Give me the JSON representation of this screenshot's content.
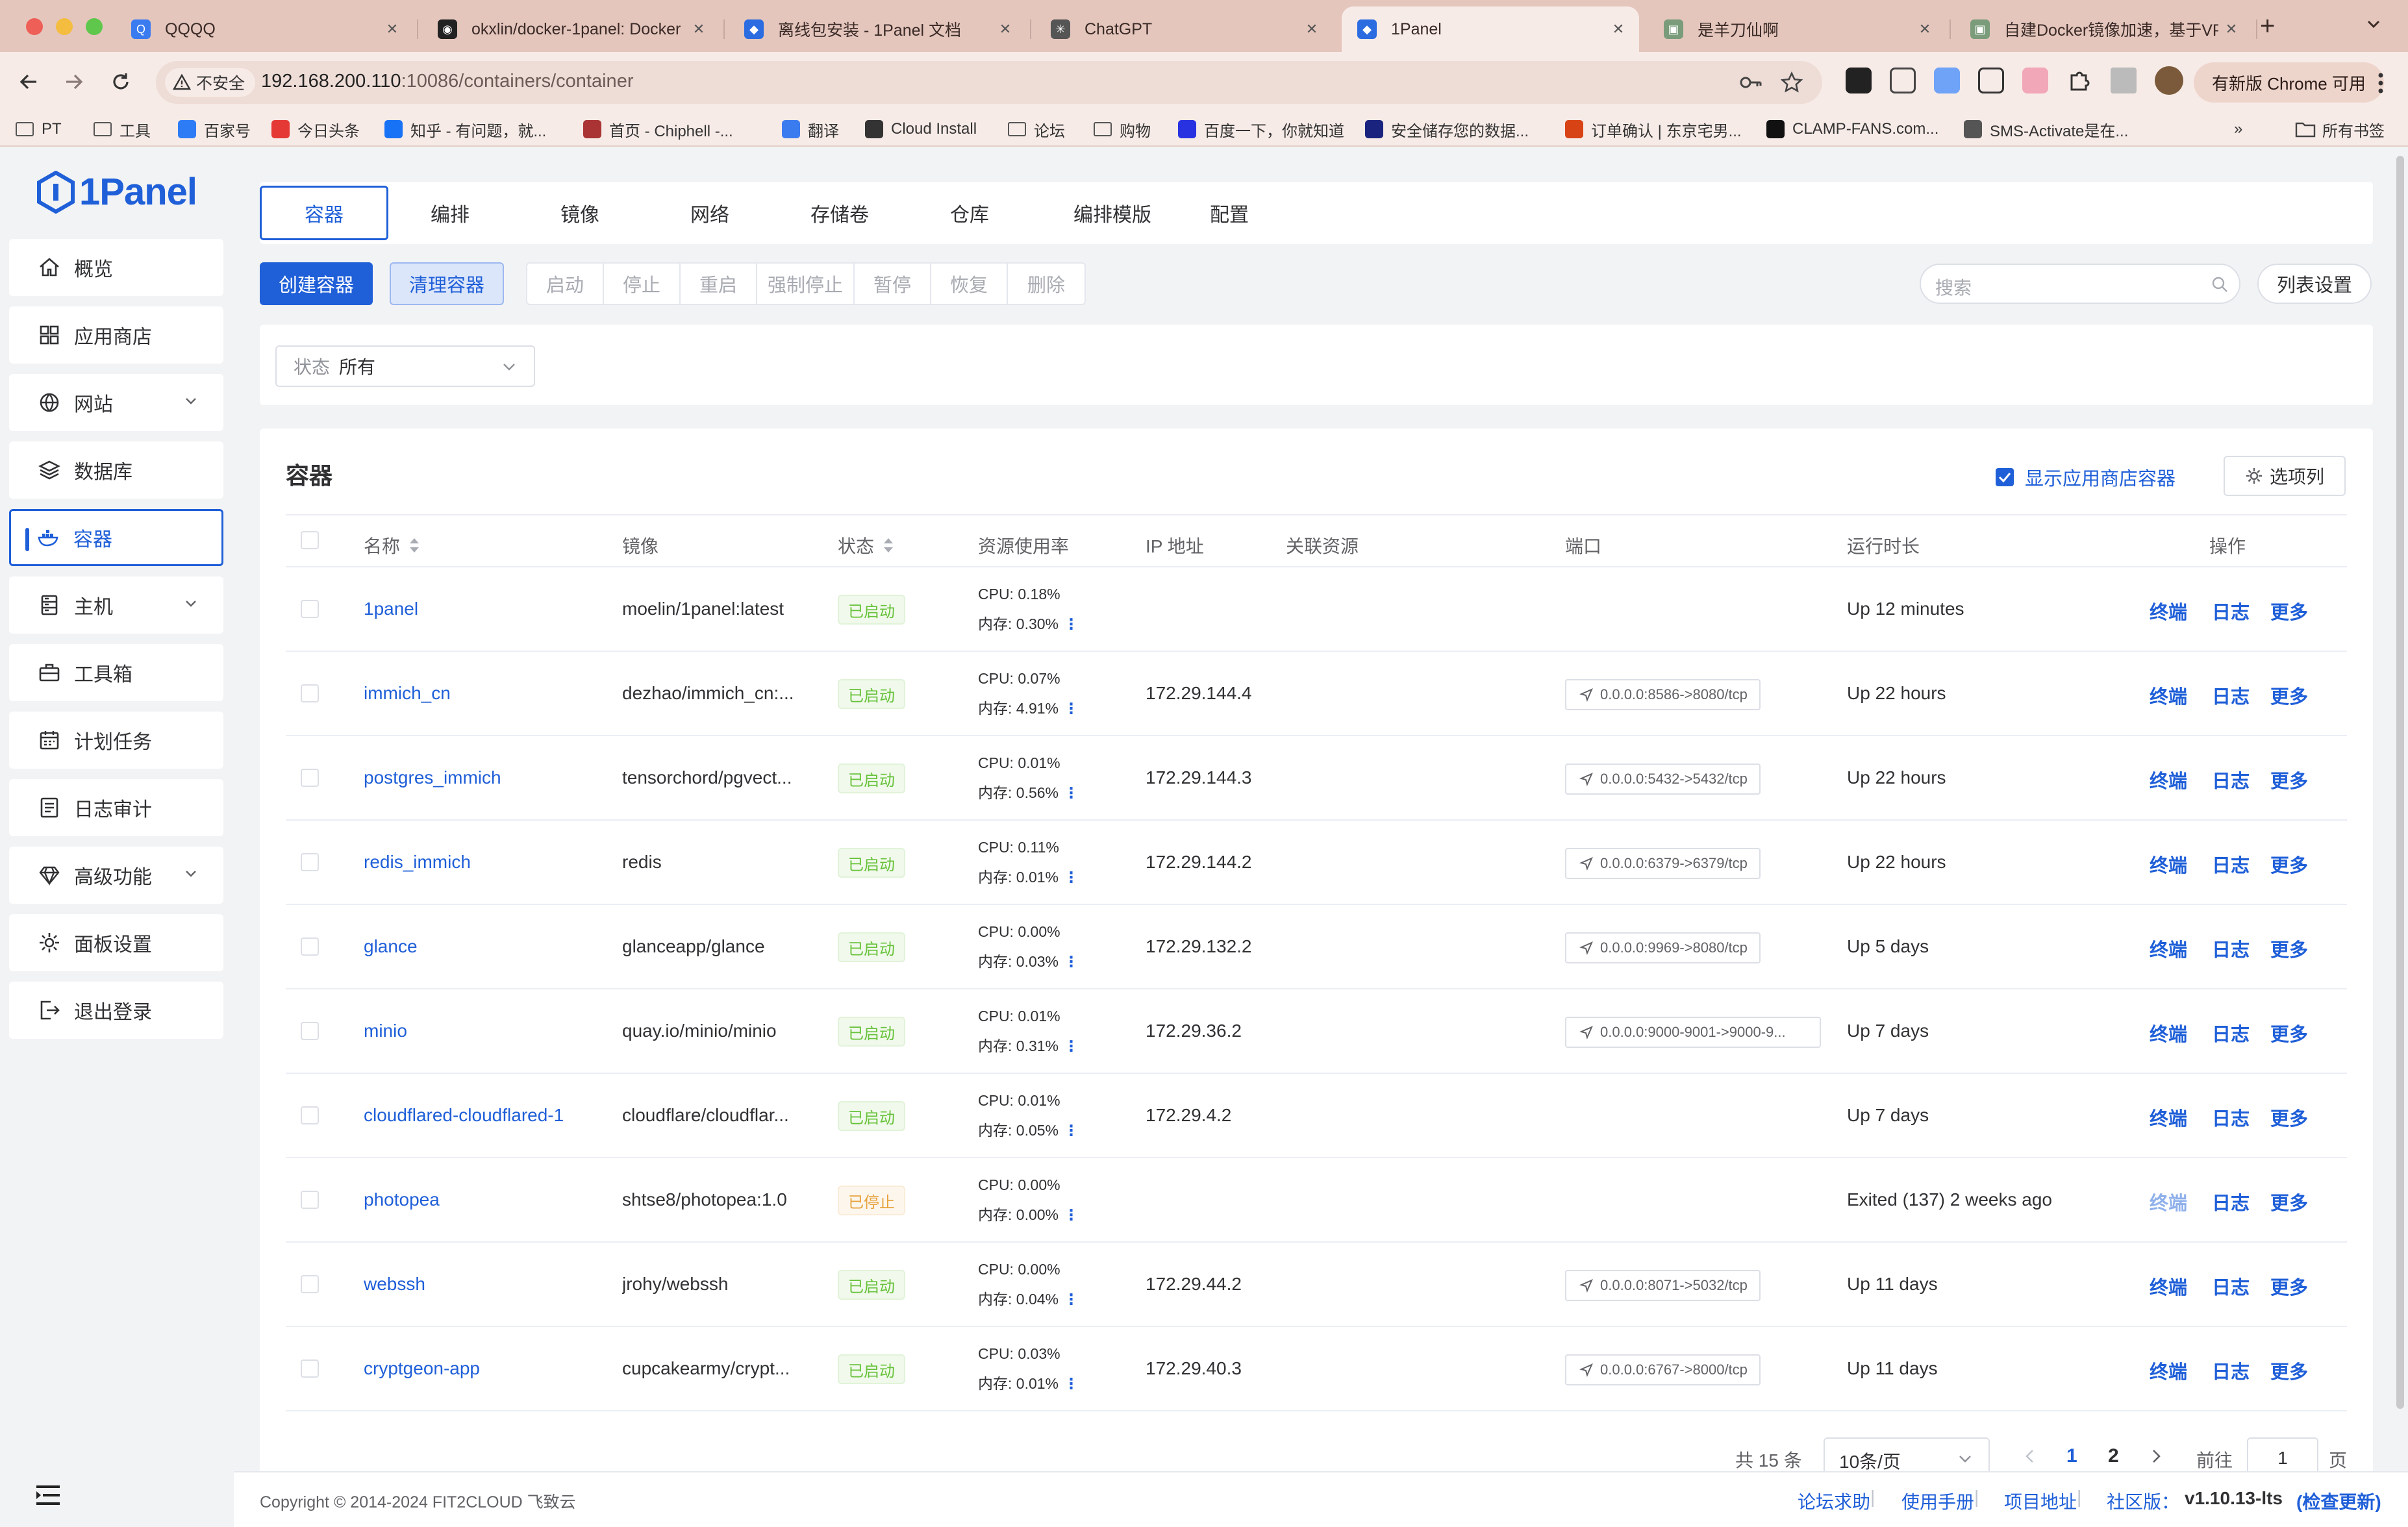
{
  "browser": {
    "tabs": [
      {
        "title": "QQQQ",
        "color": "#3b7bf0",
        "glyph": "Q"
      },
      {
        "title": "okxlin/docker-1panel: Docker",
        "color": "#222",
        "glyph": "◉"
      },
      {
        "title": "离线包安装 - 1Panel 文档",
        "color": "#2b6ce0",
        "glyph": "◆"
      },
      {
        "title": "ChatGPT",
        "color": "#555",
        "glyph": "✳"
      },
      {
        "title": "1Panel",
        "color": "#2b6ce0",
        "glyph": "◆"
      },
      {
        "title": "是羊刀仙啊",
        "color": "#7a9c7a",
        "glyph": "▣"
      },
      {
        "title": "自建Docker镜像加速，基于VP",
        "color": "#7a9c7a",
        "glyph": "▣"
      }
    ],
    "insecure_label": "不安全",
    "url_host": "192.168.200.110",
    "url_rest": ":10086/containers/container",
    "update_label": "有新版 Chrome 可用",
    "bookmarks": [
      {
        "label": "PT",
        "color": "#555"
      },
      {
        "label": "工具",
        "color": "#555"
      },
      {
        "label": "百家号",
        "color": "#2d7cf6"
      },
      {
        "label": "今日头条",
        "color": "#e53935"
      },
      {
        "label": "知乎 - 有问题，就...",
        "color": "#1772f6"
      },
      {
        "label": "首页 - Chiphell -...",
        "color": "#a33"
      },
      {
        "label": "翻译",
        "color": "#3b7bf0"
      },
      {
        "label": "Cloud Install",
        "color": "#333"
      },
      {
        "label": "论坛",
        "color": "#555"
      },
      {
        "label": "购物",
        "color": "#555"
      },
      {
        "label": "百度一下，你就知道",
        "color": "#2932e1"
      },
      {
        "label": "安全储存您的数据...",
        "color": "#1a237e"
      },
      {
        "label": "订单确认 | 东京宅男...",
        "color": "#d84315"
      },
      {
        "label": "CLAMP-FANS.com...",
        "color": "#111"
      },
      {
        "label": "SMS-Activate是在...",
        "color": "#555"
      }
    ],
    "all_bookmarks": "所有书签",
    "more_bookmarks": "»"
  },
  "brand": {
    "logo": "1Panel",
    "color": "#1f5fd8"
  },
  "sidebar": {
    "items": [
      {
        "label": "概览",
        "icon": "home-icon",
        "has_arrow": false
      },
      {
        "label": "应用商店",
        "icon": "grid-icon",
        "has_arrow": false
      },
      {
        "label": "网站",
        "icon": "globe-icon",
        "has_arrow": true
      },
      {
        "label": "数据库",
        "icon": "layers-icon",
        "has_arrow": false
      },
      {
        "label": "容器",
        "icon": "docker-icon",
        "has_arrow": false,
        "active": true
      },
      {
        "label": "主机",
        "icon": "server-icon",
        "has_arrow": true
      },
      {
        "label": "工具箱",
        "icon": "toolbox-icon",
        "has_arrow": false
      },
      {
        "label": "计划任务",
        "icon": "calendar-icon",
        "has_arrow": false
      },
      {
        "label": "日志审计",
        "icon": "log-icon",
        "has_arrow": false
      },
      {
        "label": "高级功能",
        "icon": "diamond-icon",
        "has_arrow": true
      },
      {
        "label": "面板设置",
        "icon": "gear-icon",
        "has_arrow": false
      },
      {
        "label": "退出登录",
        "icon": "logout-icon",
        "has_arrow": false
      }
    ]
  },
  "subtabs": [
    "容器",
    "编排",
    "镜像",
    "网络",
    "存储卷",
    "仓库",
    "编排模版",
    "配置"
  ],
  "toolbar": {
    "create": "创建容器",
    "prune": "清理容器",
    "actions": [
      "启动",
      "停止",
      "重启",
      "强制停止",
      "暂停",
      "恢复",
      "删除"
    ],
    "search_placeholder": "搜索",
    "columns": "列表设置"
  },
  "filter": {
    "label": "状态",
    "value": "所有"
  },
  "table": {
    "title": "容器",
    "show_app_label": "显示应用商店容器",
    "option_columns": "选项列",
    "headers": {
      "name": "名称",
      "image": "镜像",
      "state": "状态",
      "resource": "资源使用率",
      "ip": "IP 地址",
      "related": "关联资源",
      "ports": "端口",
      "uptime": "运行时长",
      "ops": "操作"
    },
    "rows": [
      {
        "name": "1panel",
        "image": "moelin/1panel:latest",
        "state": "已启动",
        "cpu": "CPU: 0.18%",
        "mem": "内存: 0.30%",
        "ip": "",
        "port": "",
        "uptime": "Up 12 minutes",
        "running": true
      },
      {
        "name": "immich_cn",
        "image": "dezhao/immich_cn:...",
        "state": "已启动",
        "cpu": "CPU: 0.07%",
        "mem": "内存: 4.91%",
        "ip": "172.29.144.4",
        "port": "0.0.0.0:8586->8080/tcp",
        "uptime": "Up 22 hours",
        "running": true
      },
      {
        "name": "postgres_immich",
        "image": "tensorchord/pgvect...",
        "state": "已启动",
        "cpu": "CPU: 0.01%",
        "mem": "内存: 0.56%",
        "ip": "172.29.144.3",
        "port": "0.0.0.0:5432->5432/tcp",
        "uptime": "Up 22 hours",
        "running": true
      },
      {
        "name": "redis_immich",
        "image": "redis",
        "state": "已启动",
        "cpu": "CPU: 0.11%",
        "mem": "内存: 0.01%",
        "ip": "172.29.144.2",
        "port": "0.0.0.0:6379->6379/tcp",
        "uptime": "Up 22 hours",
        "running": true
      },
      {
        "name": "glance",
        "image": "glanceapp/glance",
        "state": "已启动",
        "cpu": "CPU: 0.00%",
        "mem": "内存: 0.03%",
        "ip": "172.29.132.2",
        "port": "0.0.0.0:9969->8080/tcp",
        "uptime": "Up 5 days",
        "running": true
      },
      {
        "name": "minio",
        "image": "quay.io/minio/minio",
        "state": "已启动",
        "cpu": "CPU: 0.01%",
        "mem": "内存: 0.31%",
        "ip": "172.29.36.2",
        "port": "0.0.0.0:9000-9001->9000-9...",
        "uptime": "Up 7 days",
        "running": true
      },
      {
        "name": "cloudflared-cloudflared-1",
        "image": "cloudflare/cloudflar...",
        "state": "已启动",
        "cpu": "CPU: 0.01%",
        "mem": "内存: 0.05%",
        "ip": "172.29.4.2",
        "port": "",
        "uptime": "Up 7 days",
        "running": true
      },
      {
        "name": "photopea",
        "image": "shtse8/photopea:1.0",
        "state": "已停止",
        "cpu": "CPU: 0.00%",
        "mem": "内存: 0.00%",
        "ip": "",
        "port": "",
        "uptime": "Exited (137) 2 weeks ago",
        "running": false
      },
      {
        "name": "webssh",
        "image": "jrohy/webssh",
        "state": "已启动",
        "cpu": "CPU: 0.00%",
        "mem": "内存: 0.04%",
        "ip": "172.29.44.2",
        "port": "0.0.0.0:8071->5032/tcp",
        "uptime": "Up 11 days",
        "running": true
      },
      {
        "name": "cryptgeon-app",
        "image": "cupcakearmy/crypt...",
        "state": "已启动",
        "cpu": "CPU: 0.03%",
        "mem": "内存: 0.01%",
        "ip": "172.29.40.3",
        "port": "0.0.0.0:6767->8000/tcp",
        "uptime": "Up 11 days",
        "running": true
      }
    ],
    "ops": [
      "终端",
      "日志",
      "更多"
    ]
  },
  "pagination": {
    "total": "共 15 条",
    "page_size": "10条/页",
    "pages": [
      "1",
      "2"
    ],
    "current": "1",
    "goto": "前往",
    "goto_value": "1",
    "page_suffix": "页"
  },
  "footer": {
    "copyright": "Copyright © 2014-2024 FIT2CLOUD 飞致云",
    "links": [
      "论坛求助",
      "使用手册",
      "项目地址"
    ],
    "edition": "社区版：",
    "version": "v1.10.13-lts",
    "check_update": "(检查更新)"
  }
}
